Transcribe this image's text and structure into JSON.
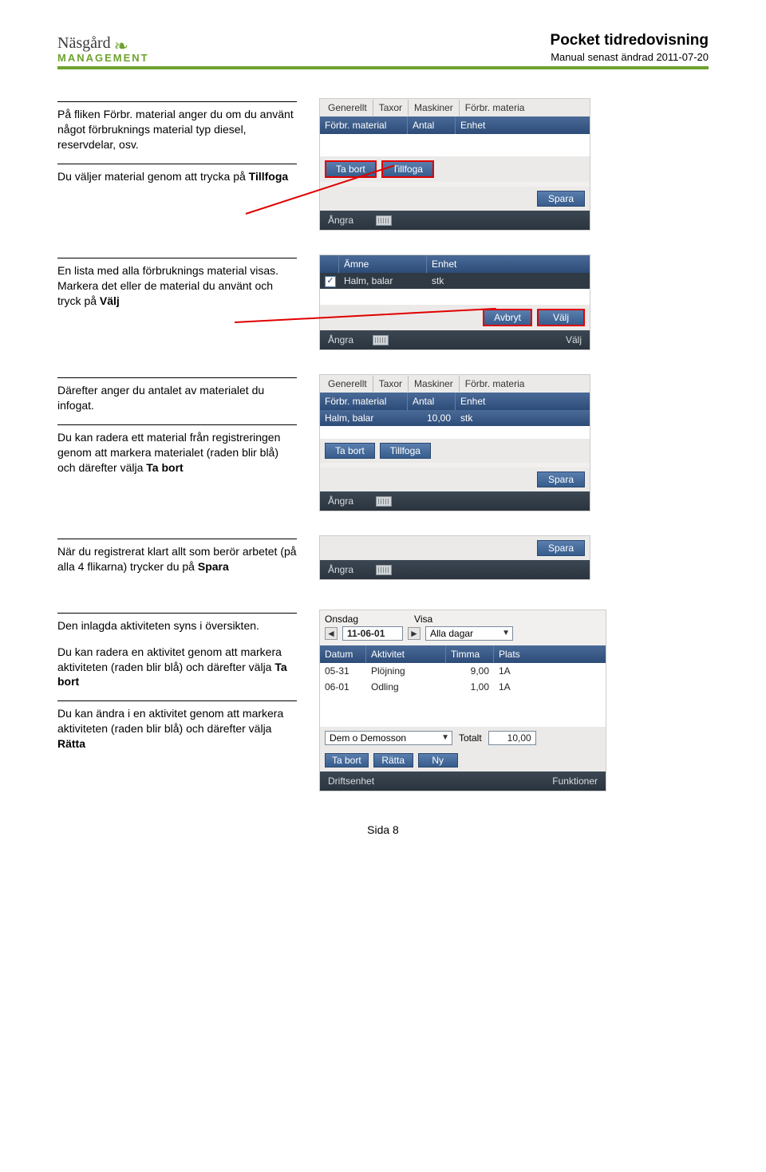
{
  "header": {
    "logo_top": "Näsgård",
    "logo_bottom": "MANAGEMENT",
    "title": "Pocket tidredovisning",
    "subtitle": "Manual senast ändrad 2011-07-20"
  },
  "sect1": {
    "p1": "På fliken Förbr. material anger du om du använt något förbruknings material typ diesel, reservdelar, osv.",
    "p2_pre": "Du väljer material genom att trycka på ",
    "p2_b": "Tillfoga",
    "shot": {
      "tabs": [
        "Generellt",
        "Taxor",
        "Maskiner",
        "Förbr. materia"
      ],
      "head": [
        "Förbr. material",
        "Antal",
        "Enhet"
      ],
      "btns": [
        "Ta bort",
        "Tillfoga"
      ],
      "spara": "Spara",
      "angra": "Ångra"
    }
  },
  "sect2": {
    "p_pre": "En lista med alla förbruknings material visas. Markera det eller de material du använt och tryck på ",
    "p_b": "Välj",
    "shot": {
      "head": [
        "",
        "Ämne",
        "Enhet"
      ],
      "row": [
        "Halm, balar",
        "stk"
      ],
      "btns": [
        "Avbryt",
        "Välj"
      ],
      "angra": "Ångra",
      "valj": "Välj"
    }
  },
  "sect3": {
    "p1": "Därefter anger du antalet av materialet du infogat.",
    "p2_pre": "Du kan radera ett material från registreringen genom att markera materialet (raden blir blå) och därefter välja ",
    "p2_b": "Ta bort",
    "shot": {
      "tabs": [
        "Generellt",
        "Taxor",
        "Maskiner",
        "Förbr. materia"
      ],
      "head": [
        "Förbr. material",
        "Antal",
        "Enhet"
      ],
      "row": [
        "Halm, balar",
        "10,00",
        "stk"
      ],
      "btns": [
        "Ta bort",
        "Tillfoga"
      ],
      "spara": "Spara",
      "angra": "Ångra"
    }
  },
  "sect4": {
    "p_pre": "När du registrerat klart allt som berör arbetet (på alla 4 flikarna) trycker du på ",
    "p_b": "Spara",
    "shot": {
      "spara": "Spara",
      "angra": "Ångra"
    }
  },
  "sect5": {
    "p1": "Den inlagda aktiviteten syns i översikten.",
    "p2_pre": "Du kan radera en aktivitet genom att markera aktiviteten (raden blir blå) och därefter välja ",
    "p2_b": "Ta bort",
    "p3_pre": "Du kan ändra i en aktivitet genom att markera aktiviteten (raden blir blå) och därefter välja ",
    "p3_b": "Rätta",
    "shot": {
      "onsdag": "Onsdag",
      "visa": "Visa",
      "date": "11-06-01",
      "alla": "Alla dagar",
      "head": [
        "Datum",
        "Aktivitet",
        "Timma",
        "Plats"
      ],
      "rows": [
        [
          "05-31",
          "Plöjning",
          "9,00",
          "1A"
        ],
        [
          "06-01",
          "Odling",
          "1,00",
          "1A"
        ]
      ],
      "demo": "Dem o Demosson",
      "totalt_lbl": "Totalt",
      "totalt_val": "10,00",
      "btns": [
        "Ta bort",
        "Rätta",
        "Ny"
      ],
      "driftsenhet": "Driftsenhet",
      "funktioner": "Funktioner"
    }
  },
  "footer": "Sida 8"
}
